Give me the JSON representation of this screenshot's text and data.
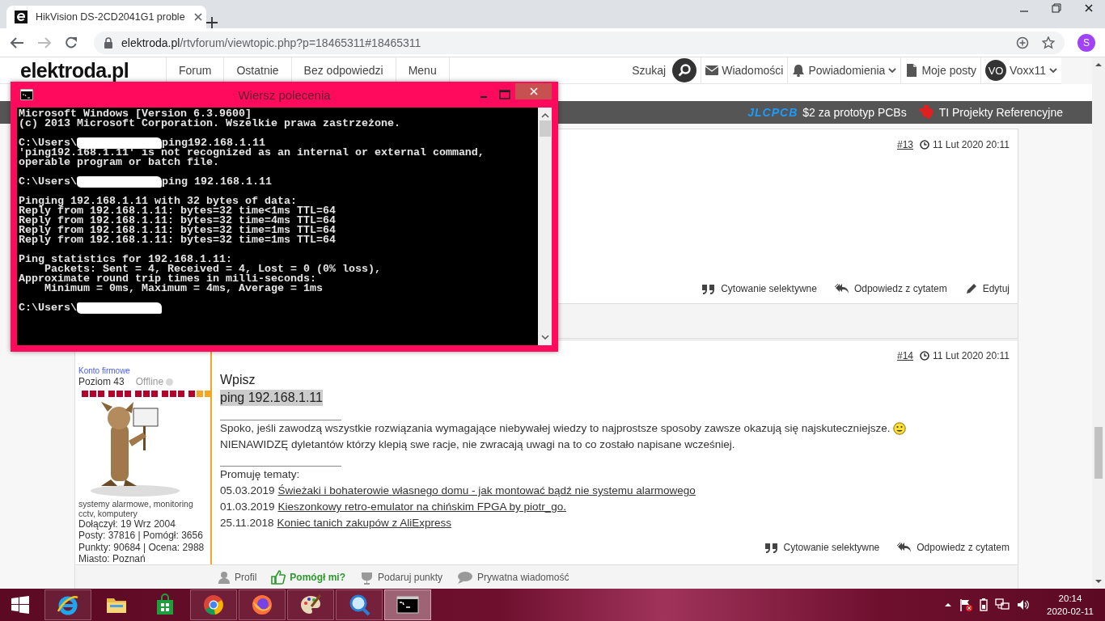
{
  "browser": {
    "tab_title": "HikVision DS-2CD2041G1 proble",
    "url_host": "elektroda.pl",
    "url_path": "/rtvforum/viewtopic.php?p=18465311#18465311",
    "profile_initial": "S"
  },
  "site": {
    "logo": "elektroda.pl",
    "nav": [
      "Forum",
      "Ostatnie",
      "Bez odpowiedzi",
      "Menu"
    ],
    "search_label": "Szukaj",
    "user_links": [
      {
        "kind": "mail",
        "label": "Wiadomości",
        "dropdown": false
      },
      {
        "kind": "bell",
        "label": "Powiadomienia",
        "dropdown": true
      },
      {
        "kind": "doc",
        "label": "Moje posty",
        "dropdown": false
      }
    ],
    "user": {
      "initials": "VO",
      "name": "Voxx11"
    }
  },
  "ad_bar": {
    "brand": "JLCPCB",
    "items": [
      "$2 za prototyp PCBs",
      "TI Projekty Referencyjne"
    ]
  },
  "posts": [
    {
      "number": "#13",
      "time": "11 Lut 2020 20:11",
      "actions": [
        {
          "kind": "quote",
          "label": "Cytowanie selektywne"
        },
        {
          "kind": "reply",
          "label": "Odpowiedz z cytatem"
        },
        {
          "kind": "edit",
          "label": "Edytuj"
        }
      ]
    },
    {
      "number": "#14",
      "time": "11 Lut 2020 20:11",
      "user": {
        "account_type": "Konto firmowe",
        "level": "Poziom 43",
        "status": "Offline",
        "online": false,
        "avatar": {
          "kind": "picture"
        },
        "description": "systemy alarmowe, monitoring cctv, komputery",
        "stats": [
          "Dołączył: 19 Wrz 2004",
          "Posty: 37816 | Pomógł: 3656",
          "Punkty: 90684 | Ocena: 2988",
          "Miasto: Poznań"
        ]
      },
      "body": [
        {
          "kind": "plain",
          "text": "Wpisz"
        },
        {
          "kind": "highlight",
          "text": "ping 192.168.1.11"
        }
      ],
      "signature": [
        {
          "text": "Spoko, jeśli zawodzą wszystkie rozwiązania wymagające niebywałej wiedzy to najprostsze sposoby zawsze okazują się najskuteczniejsze.",
          "emoticon": true
        },
        {
          "text": "NIENAWIDZĘ dyletantów którzy klepią swe racje, nie zwracają uwagi na to co zostało napisane wcześniej.",
          "emoticon": false
        }
      ],
      "promo": {
        "title": "Promuję tematy:",
        "items": [
          {
            "date": "05.03.2019",
            "link": "Świeżaki i bohaterowie własnego domu - jak montować bądź nie systemu alarmowego"
          },
          {
            "date": "01.03.2019",
            "link": "Kieszonkowy retro-emulator na chińskim FPGA by piotr_go."
          },
          {
            "date": "25.11.2018",
            "link": "Koniec tanich zakupów z AliExpress"
          }
        ]
      },
      "actions": [
        {
          "kind": "quote",
          "label": "Cytowanie selektywne"
        },
        {
          "kind": "reply",
          "label": "Odpowiedz z cytatem"
        }
      ],
      "footer": [
        {
          "kind": "profile",
          "label": "Profil"
        },
        {
          "kind": "helped",
          "label": "Pomógł mi?"
        },
        {
          "kind": "gift",
          "label": "Podaruj punkty"
        },
        {
          "kind": "message",
          "label": "Prywatna wiadomość"
        }
      ]
    }
  ],
  "cmd_window": {
    "title": "Wiersz polecenia",
    "blocks": [
      [
        {
          "kind": "output",
          "text": "Microsoft Windows [Version 6.3.9600]"
        },
        {
          "kind": "output",
          "text": "(c) 2013 Microsoft Corporation. Wszelkie prawa zastrzeżone."
        }
      ],
      [
        {
          "kind": "prompt",
          "text": "C:\\Users\\",
          "command": "ping192.168.1.11"
        },
        {
          "kind": "output",
          "text": "'ping192.168.1.11' is not recognized as an internal or external command,"
        },
        {
          "kind": "output",
          "text": "operable program or batch file."
        }
      ],
      [
        {
          "kind": "prompt",
          "text": "C:\\Users\\",
          "command": "ping 192.168.1.11"
        }
      ],
      [
        {
          "kind": "output",
          "text": "Pinging 192.168.1.11 with 32 bytes of data:"
        },
        {
          "kind": "output",
          "text": "Reply from 192.168.1.11: bytes=32 time<1ms TTL=64"
        },
        {
          "kind": "output",
          "text": "Reply from 192.168.1.11: bytes=32 time=4ms TTL=64"
        },
        {
          "kind": "output",
          "text": "Reply from 192.168.1.11: bytes=32 time=1ms TTL=64"
        },
        {
          "kind": "output",
          "text": "Reply from 192.168.1.11: bytes=32 time=1ms TTL=64"
        }
      ],
      [
        {
          "kind": "output",
          "text": "Ping statistics for 192.168.1.11:"
        },
        {
          "kind": "output",
          "text": "    Packets: Sent = 4, Received = 4, Lost = 0 (0% loss),"
        },
        {
          "kind": "output",
          "text": "Approximate round trip times in milli-seconds:"
        },
        {
          "kind": "output",
          "text": "    Minimum = 0ms, Maximum = 4ms, Average = 1ms"
        }
      ],
      [
        {
          "kind": "prompt",
          "text": "C:\\Users\\"
        }
      ]
    ]
  },
  "taskbar": {
    "apps": [
      {
        "kind": "ie",
        "running": true,
        "selected": false
      },
      {
        "kind": "explorer",
        "running": false,
        "selected": false
      },
      {
        "kind": "store",
        "running": false,
        "selected": false
      },
      {
        "kind": "chrome",
        "running": true,
        "selected": false
      },
      {
        "kind": "firefox",
        "running": true,
        "selected": false
      },
      {
        "kind": "paint",
        "running": true,
        "selected": false
      },
      {
        "kind": "magnifier",
        "running": true,
        "selected": false
      },
      {
        "kind": "cmd",
        "running": true,
        "selected": true
      }
    ],
    "time": "20:14",
    "date": "2020-02-11"
  }
}
